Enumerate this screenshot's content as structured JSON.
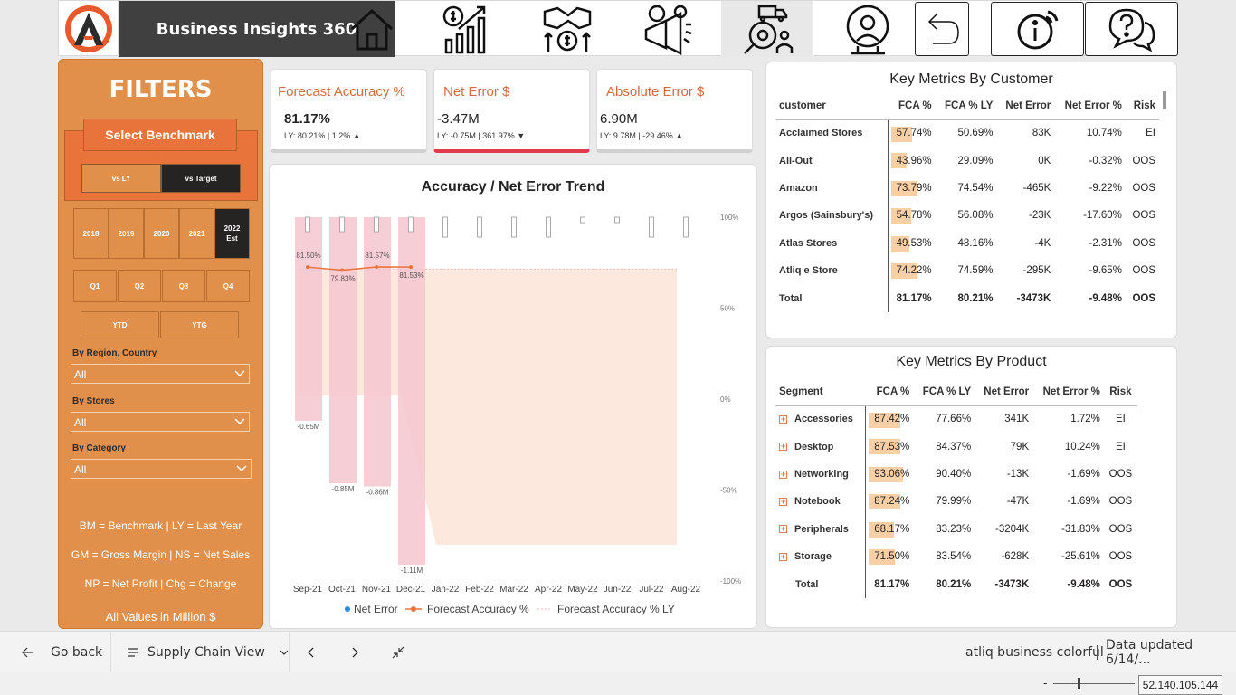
{
  "app": {
    "brand": "Business Insights 360"
  },
  "filters": {
    "title": "FILTERS",
    "benchmark_title": "Select Benchmark",
    "benchmark_options": [
      "vs LY",
      "vs Target"
    ],
    "years": [
      "2018",
      "2019",
      "2020",
      "2021",
      "2022 Est"
    ],
    "quarters": [
      "Q1",
      "Q2",
      "Q3",
      "Q4"
    ],
    "periods": [
      "YTD",
      "YTG"
    ],
    "region_label": "By Region, Country",
    "region_value": "All",
    "stores_label": "By Stores",
    "stores_value": "All",
    "category_label": "By Category",
    "category_value": "All",
    "notes": [
      "BM = Benchmark | LY = Last Year",
      "GM = Gross Margin | NS = Net Sales",
      "NP = Net Profit | Chg = Change"
    ],
    "units_note": "All Values in Million $"
  },
  "kpis": [
    {
      "title": "Forecast Accuracy %",
      "value": "81.17%",
      "sub": "LY: 80.21% | 1.2% ▲"
    },
    {
      "title": "Net Error $",
      "value": "-3.47M",
      "sub": "LY: -0.75M | 361.97% ▼"
    },
    {
      "title": "Absolute Error $",
      "value": "6.90M",
      "sub": "LY: 9.78M | -29.46% ▲"
    }
  ],
  "chart_data": {
    "type": "bar",
    "title": "Accuracy / Net Error Trend",
    "categories": [
      "Sep-21",
      "Oct-21",
      "Nov-21",
      "Dec-21",
      "Jan-22",
      "Feb-22",
      "Mar-22",
      "Apr-22",
      "May-22",
      "Jun-22",
      "Jul-22",
      "Aug-22"
    ],
    "series": [
      {
        "name": "Net Error",
        "values": [
          -0.65,
          -0.85,
          -0.86,
          -1.11,
          null,
          null,
          null,
          null,
          null,
          null,
          null,
          null
        ],
        "labels": [
          "-0.65M",
          "-0.85M",
          "-0.86M",
          "-1.11M"
        ]
      },
      {
        "name": "Forecast Accuracy %",
        "values": [
          81.5,
          79.83,
          81.57,
          81.53,
          null,
          null,
          null,
          null,
          null,
          null,
          null,
          null
        ],
        "labels": [
          "81.50%",
          "79.83%",
          "81.57%",
          "81.53%"
        ]
      },
      {
        "name": "Forecast Accuracy % LY",
        "values": [
          80,
          80,
          80,
          80,
          80,
          80,
          80,
          80,
          80,
          80,
          80,
          80
        ]
      }
    ],
    "y2_ticks": [
      "100%",
      "50%",
      "0%",
      "-50%",
      "-100%"
    ],
    "y2lim": [
      -100,
      100
    ],
    "legend": [
      "Net Error",
      "Forecast Accuracy %",
      "Forecast Accuracy % LY"
    ],
    "legend_position": "bottom"
  },
  "customer_table": {
    "title": "Key Metrics By Customer",
    "headers": [
      "customer",
      "FCA %",
      "FCA % LY",
      "Net Error",
      "Net Error %",
      "Risk"
    ],
    "rows": [
      [
        "Acclaimed Stores",
        "57.74%",
        "50.69%",
        "83K",
        "10.74%",
        "EI"
      ],
      [
        "All-Out",
        "43.96%",
        "29.09%",
        "0K",
        "-0.32%",
        "OOS"
      ],
      [
        "Amazon",
        "73.79%",
        "74.54%",
        "-465K",
        "-9.22%",
        "OOS"
      ],
      [
        "Argos (Sainsbury's)",
        "54.78%",
        "56.08%",
        "-23K",
        "-17.60%",
        "OOS"
      ],
      [
        "Atlas Stores",
        "49.53%",
        "48.16%",
        "-4K",
        "-2.31%",
        "OOS"
      ],
      [
        "Atliq e Store",
        "74.22%",
        "74.59%",
        "-295K",
        "-9.65%",
        "OOS"
      ]
    ],
    "fca_values": [
      57.74,
      43.96,
      73.79,
      54.78,
      49.53,
      74.22
    ],
    "total": [
      "Total",
      "81.17%",
      "80.21%",
      "-3473K",
      "-9.48%",
      "OOS"
    ]
  },
  "product_table": {
    "title": "Key Metrics By Product",
    "headers": [
      "Segment",
      "FCA %",
      "FCA % LY",
      "Net Error",
      "Net Error %",
      "Risk"
    ],
    "rows": [
      [
        "Accessories",
        "87.42%",
        "77.66%",
        "341K",
        "1.72%",
        "EI"
      ],
      [
        "Desktop",
        "87.53%",
        "84.37%",
        "79K",
        "10.24%",
        "EI"
      ],
      [
        "Networking",
        "93.06%",
        "90.40%",
        "-13K",
        "-1.69%",
        "OOS"
      ],
      [
        "Notebook",
        "87.24%",
        "79.99%",
        "-47K",
        "-1.69%",
        "OOS"
      ],
      [
        "Peripherals",
        "68.17%",
        "83.23%",
        "-3204K",
        "-31.83%",
        "OOS"
      ],
      [
        "Storage",
        "71.50%",
        "83.54%",
        "-628K",
        "-25.61%",
        "OOS"
      ]
    ],
    "fca_values": [
      87.42,
      87.53,
      93.06,
      87.24,
      68.17,
      71.5
    ],
    "total": [
      "Total",
      "81.17%",
      "80.21%",
      "-3473K",
      "-9.48%",
      "OOS"
    ]
  },
  "bottom": {
    "go_back": "Go back",
    "page_name": "Supply Chain View",
    "report_name": "atliq business colorful",
    "data_updated": "Data updated 6/14/...",
    "ip": "52.140.105.144",
    "zoom_minus": "-"
  },
  "colors": {
    "accent": "#e0904a",
    "dark": "#252423",
    "error_bar": "#f4c6cf",
    "line": "#e8743b"
  }
}
